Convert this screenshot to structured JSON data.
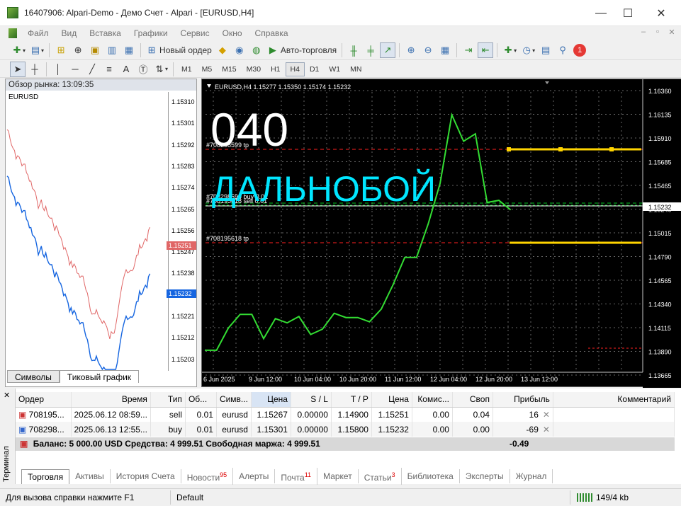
{
  "window": {
    "title": "16407906: Alpari-Demo - Демо Счет - Alpari - [EURUSD,H4]"
  },
  "menu": [
    "Файл",
    "Вид",
    "Вставка",
    "Графики",
    "Сервис",
    "Окно",
    "Справка"
  ],
  "toolbar1": {
    "new_order": "Новый ордер",
    "autotrading": "Авто-торговля",
    "notification_count": "1"
  },
  "timeframes": [
    "M1",
    "M5",
    "M15",
    "M30",
    "H1",
    "H4",
    "D1",
    "W1",
    "MN"
  ],
  "active_timeframe": "H4",
  "market_watch": {
    "header": "Обзор рынка: 13:09:35",
    "symbol": "EURUSD",
    "tabs": [
      "Символы",
      "Тиковый график"
    ],
    "price_labels": [
      "1.15310",
      "1.15301",
      "1.15292",
      "1.15283",
      "1.15274",
      "1.15265",
      "1.15256",
      "1.15247",
      "1.15238",
      "1.15230",
      "1.15221",
      "1.15212",
      "1.15203"
    ],
    "bid_marker": "1.15251",
    "ask_marker": "1.15232"
  },
  "chart": {
    "info": "EURUSD,H4  1.15277 1.15350 1.15174 1.15232",
    "overlay_number": "040",
    "overlay_text": "ДАЛЬНОБОЙ",
    "line_tp1": "#708298599 tp",
    "line_entry": "#708298599 buy 0.01",
    "line_entry2": "#708195618 sell 0.01",
    "line_tp2": "#708195618 tp",
    "price_axis": [
      "1.16360",
      "1.16135",
      "1.15910",
      "1.15685",
      "1.15465",
      "1.15240",
      "1.15015",
      "1.14790",
      "1.14565",
      "1.14340",
      "1.14115",
      "1.13890",
      "1.13665"
    ],
    "current_price": "1.15232",
    "time_axis": [
      "6 Jun 2025",
      "9 Jun 12:00",
      "10 Jun 04:00",
      "10 Jun 20:00",
      "11 Jun 12:00",
      "12 Jun 04:00",
      "12 Jun 20:00",
      "13 Jun 12:00"
    ]
  },
  "chart_data": {
    "type": "line",
    "title": "",
    "series": [
      {
        "values": [
          1.139,
          1.139,
          1.1411,
          1.1424,
          1.1424,
          1.1401,
          1.142,
          1.1416,
          1.1422,
          1.1405,
          1.141,
          1.1425,
          1.1421,
          1.1421,
          1.1417,
          1.1429,
          1.1452,
          1.1478,
          1.1478,
          1.151,
          1.1548,
          1.1613,
          1.1588,
          1.1595,
          1.153,
          1.1532,
          1.1523
        ]
      }
    ],
    "ylim": [
      1.13665,
      1.1636
    ]
  },
  "orders": {
    "columns": [
      "Ордер",
      "Время",
      "Тип",
      "Об...",
      "Симв...",
      "Цена",
      "S / L",
      "T / P",
      "Цена",
      "Комис...",
      "Своп",
      "Прибыль",
      "Комментарий"
    ],
    "rows": [
      [
        "708195...",
        "2025.06.12 08:59...",
        "sell",
        "0.01",
        "eurusd",
        "1.15267",
        "0.00000",
        "1.14900",
        "1.15251",
        "0.00",
        "0.04",
        "16"
      ],
      [
        "708298...",
        "2025.06.13 12:55...",
        "buy",
        "0.01",
        "eurusd",
        "1.15301",
        "0.00000",
        "1.15800",
        "1.15232",
        "0.00",
        "0.00",
        "-69"
      ]
    ],
    "balance": "Баланс: 5 000.00 USD  Средства: 4 999.51  Свободная маржа: 4 999.51",
    "total": "-0.49"
  },
  "terminal": {
    "label": "Терминал",
    "tabs": [
      {
        "label": "Торговля",
        "badge": ""
      },
      {
        "label": "Активы",
        "badge": ""
      },
      {
        "label": "История Счета",
        "badge": ""
      },
      {
        "label": "Новости",
        "badge": "95"
      },
      {
        "label": "Алерты",
        "badge": ""
      },
      {
        "label": "Почта",
        "badge": "11"
      },
      {
        "label": "Маркет",
        "badge": ""
      },
      {
        "label": "Статьи",
        "badge": "3"
      },
      {
        "label": "Библиотека",
        "badge": ""
      },
      {
        "label": "Эксперты",
        "badge": ""
      },
      {
        "label": "Журнал",
        "badge": ""
      }
    ]
  },
  "status": {
    "help": "Для вызова справки нажмите F1",
    "profile": "Default",
    "traffic": "149/4 kb"
  },
  "colors": {
    "chart_line": "#00ff00",
    "tp_line": "#ff0000",
    "sl_marker": "#ffff00",
    "entry_line": "#00e5ff",
    "overlay_text": "#00ffff"
  }
}
